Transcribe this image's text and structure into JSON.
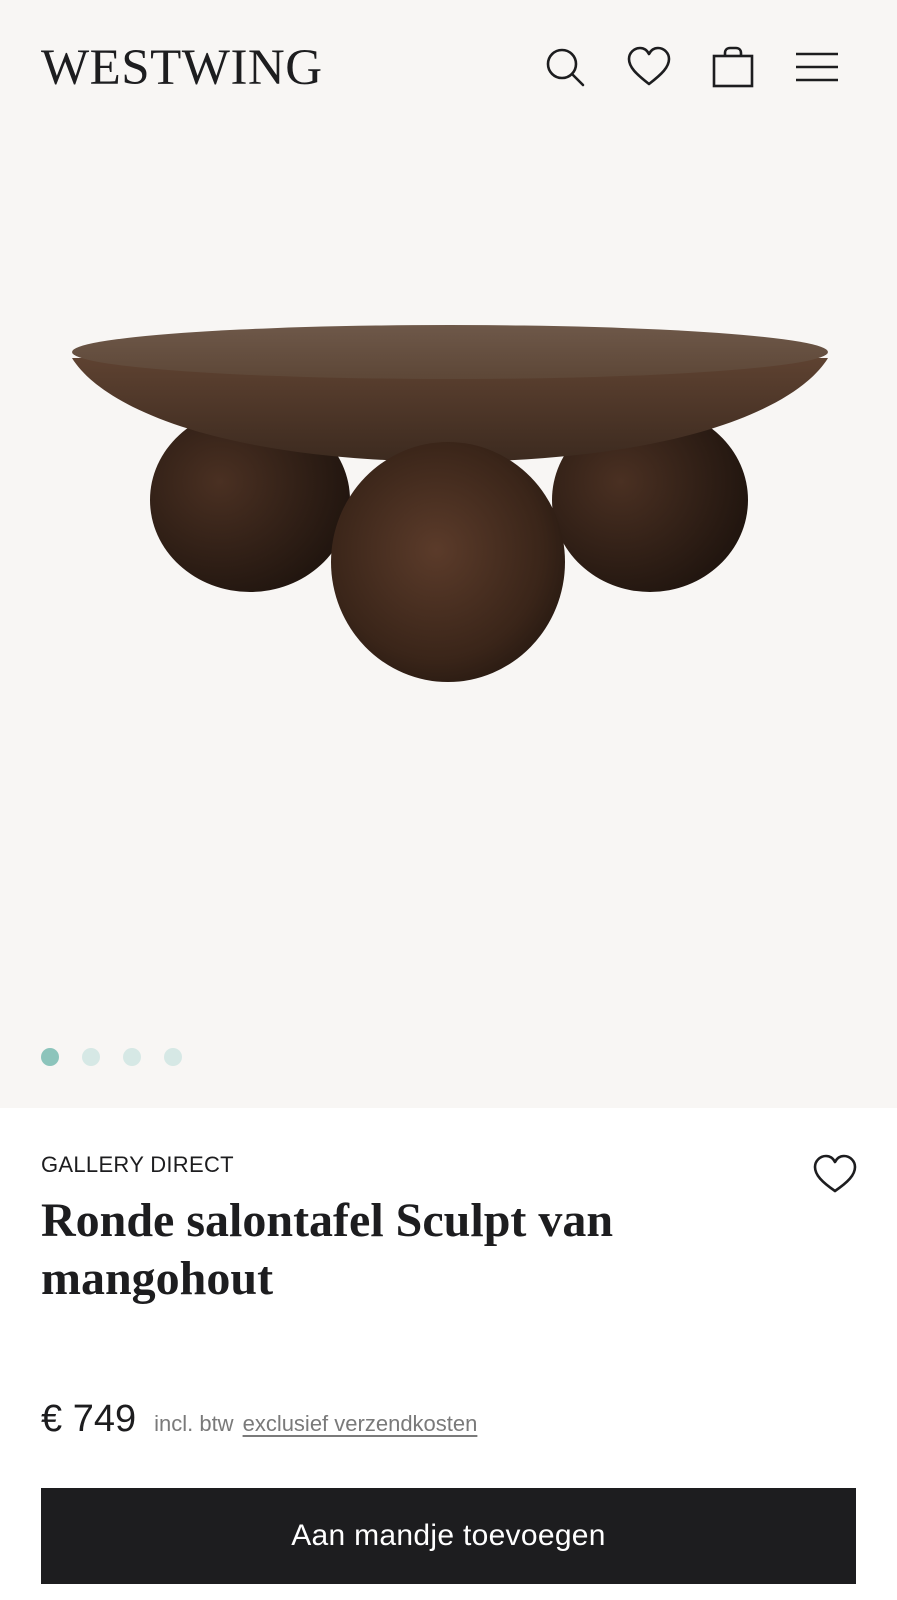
{
  "header": {
    "logo": "WESTWING",
    "icons": [
      "search-icon",
      "heart-icon",
      "bag-icon",
      "menu-icon"
    ]
  },
  "gallery": {
    "image_alt": "Ronde salontafel Sculpt van mangohout",
    "slide_count": 4,
    "active_slide": 1
  },
  "product": {
    "brand": "GALLERY DIRECT",
    "title": "Ronde salontafel Sculpt van mangohout",
    "price": "€ 749",
    "vat_note": "incl. btw",
    "shipping_link": "exclusief verzendkosten",
    "add_to_cart_label": "Aan mandje toevoegen"
  },
  "colors": {
    "hero_background": "#f8f6f4",
    "cta_background": "#1d1d1f",
    "dot_active": "#8cc4bb",
    "dot_inactive": "#d6e8e5"
  }
}
